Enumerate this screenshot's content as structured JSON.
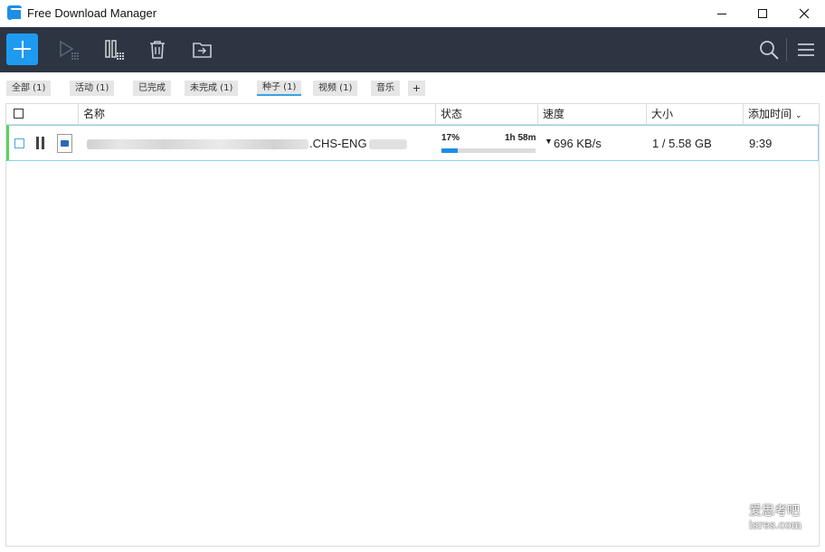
{
  "window": {
    "title": "Free Download Manager"
  },
  "toolbar": {
    "icons": [
      "add-icon",
      "play-icon",
      "pause-all-icon",
      "trash-icon",
      "move-folder-icon",
      "search-icon",
      "hamburger-menu-icon"
    ]
  },
  "filters": [
    {
      "label": "全部 (1)",
      "active": false
    },
    {
      "label": "活动 (1)",
      "active": false
    },
    {
      "label": "已完成",
      "active": false
    },
    {
      "label": "未完成 (1)",
      "active": false
    },
    {
      "label": "种子 (1)",
      "active": true
    },
    {
      "label": "视频 (1)",
      "active": false
    },
    {
      "label": "音乐",
      "active": false
    }
  ],
  "filter_add_label": "+",
  "table": {
    "columns": {
      "name": "名称",
      "status": "状态",
      "speed": "速度",
      "size": "大小",
      "added": "添加时间"
    },
    "rows": [
      {
        "name_visible": ".CHS-ENG",
        "status_percent_label": "17%",
        "progress": 0.17,
        "eta": "1h 58m",
        "speed": "696 KB/s",
        "size": "1 / 5.58 GB",
        "added": "9:39"
      }
    ]
  },
  "watermark": {
    "line1": "爱思考吧",
    "line2": "isres.com"
  },
  "colors": {
    "toolbar_bg": "#2d3543",
    "accent": "#1e9bf0",
    "row_border": "#8fd0ee",
    "row_status_bar": "#5bd35b",
    "progress": "#1e8ee6"
  }
}
